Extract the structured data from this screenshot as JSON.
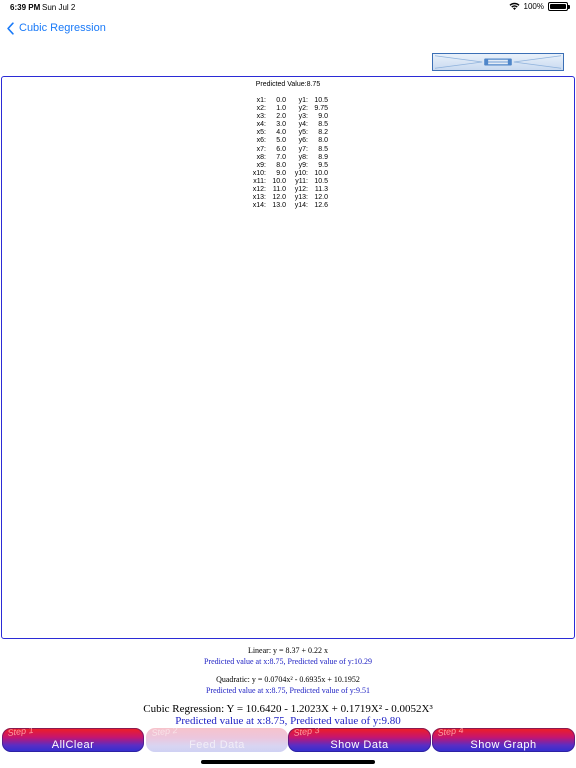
{
  "status": {
    "time": "6:39 PM",
    "date": "Sun Jul 2",
    "battery": "100%"
  },
  "nav": {
    "back_label": "Cubic Regression"
  },
  "panel": {
    "predicted_header": "Predicted Value:8.75",
    "rows": [
      {
        "xl": "x1:",
        "xv": "0.0",
        "yl": "y1:",
        "yv": "10.5"
      },
      {
        "xl": "x2:",
        "xv": "1.0",
        "yl": "y2:",
        "yv": "9.75"
      },
      {
        "xl": "x3:",
        "xv": "2.0",
        "yl": "y3:",
        "yv": "9.0"
      },
      {
        "xl": "x4:",
        "xv": "3.0",
        "yl": "y4:",
        "yv": "8.5"
      },
      {
        "xl": "x5:",
        "xv": "4.0",
        "yl": "y5:",
        "yv": "8.2"
      },
      {
        "xl": "x6:",
        "xv": "5.0",
        "yl": "y6:",
        "yv": "8.0"
      },
      {
        "xl": "x7:",
        "xv": "6.0",
        "yl": "y7:",
        "yv": "8.5"
      },
      {
        "xl": "x8:",
        "xv": "7.0",
        "yl": "y8:",
        "yv": "8.9"
      },
      {
        "xl": "x9:",
        "xv": "8.0",
        "yl": "y9:",
        "yv": "9.5"
      },
      {
        "xl": "x10:",
        "xv": "9.0",
        "yl": "y10:",
        "yv": "10.0"
      },
      {
        "xl": "x11:",
        "xv": "10.0",
        "yl": "y11:",
        "yv": "10.5"
      },
      {
        "xl": "x12:",
        "xv": "11.0",
        "yl": "y12:",
        "yv": "11.3"
      },
      {
        "xl": "x13:",
        "xv": "12.0",
        "yl": "y13:",
        "yv": "12.0"
      },
      {
        "xl": "x14:",
        "xv": "13.0",
        "yl": "y14:",
        "yv": "12.6"
      }
    ]
  },
  "results": {
    "linear_eq": "Linear: y = 8.37 + 0.22 x",
    "linear_pred": "Predicted value at x:8.75, Predicted value of y:10.29",
    "quadratic_eq": "Quadratic: y = 0.0704x² - 0.6935x + 10.1952",
    "quadratic_pred": "Predicted value at x:8.75, Predicted value of y:9.51",
    "cubic_eq": "Cubic Regression: Y = 10.6420 - 1.2023X + 0.1719X² - 0.0052X³",
    "cubic_pred": "Predicted value at x:8.75, Predicted value of y:9.80"
  },
  "steps": [
    {
      "tag": "Step 1",
      "label": "AllClear"
    },
    {
      "tag": "Step 2",
      "label": "Feed Data"
    },
    {
      "tag": "Step 3",
      "label": "Show Data"
    },
    {
      "tag": "Step 4",
      "label": "Show Graph"
    }
  ],
  "colors": {
    "accent": "#1a7af8",
    "panel_border": "#2b2bd6",
    "result_text": "#1f22c4",
    "button_top": "#f11f1f",
    "button_bottom": "#2e2fd1"
  }
}
